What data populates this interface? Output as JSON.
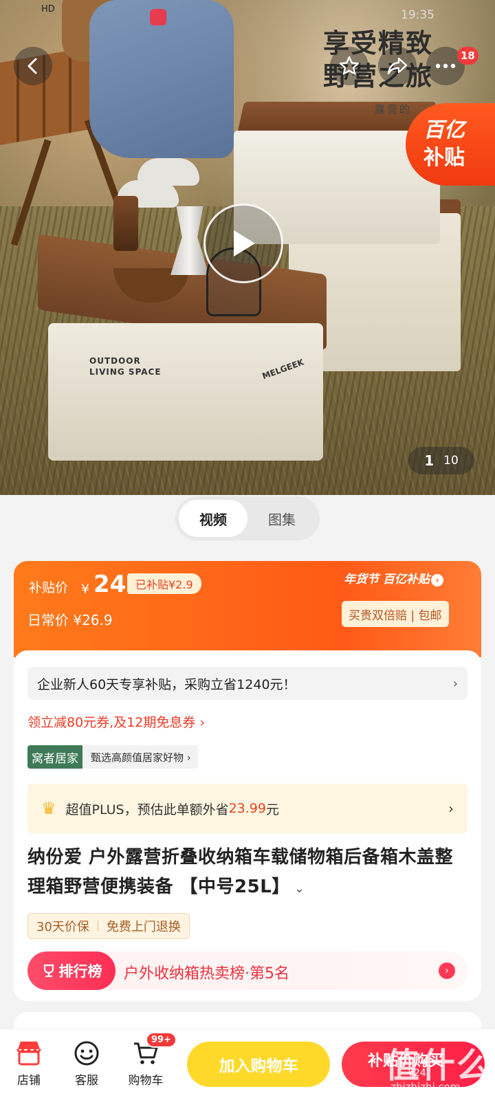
{
  "status_bar": {
    "left_text": "HD",
    "time": "19:35"
  },
  "hero": {
    "headline_line1": "享受精致",
    "headline_line2": "野营之旅",
    "subline": "露营的",
    "box_text": "OUTDOOR\nLIVING SPACE",
    "box_brand": "MELGEEK",
    "notification_count": "18",
    "subsidy_tag_line1": "百亿",
    "subsidy_tag_line2": "补贴",
    "pager_current": "1",
    "pager_total": "10"
  },
  "media_toggle": {
    "video": "视频",
    "gallery": "图集"
  },
  "price": {
    "label": "补贴价",
    "currency": "¥",
    "value": "24",
    "subsidy_badge": "已补贴¥2.9",
    "daily_label": "日常价 ¥26.9",
    "brand": "年货节 百亿补贴",
    "guarantee": "买贵双倍赔 | 包邮"
  },
  "info": {
    "promo": "企业新人60天专享补贴，采购立省1240元！",
    "coupon": "领立减80元券,及12期免息券 ›",
    "tag": "窝者居家",
    "tag_text": "甄选高颜值居家好物 ›",
    "plus_prefix": "超值PLUS，预估此单额外省",
    "plus_amount": "23.99",
    "plus_suffix": "元",
    "title": "纳份爱 户外露营折叠收纳箱车载储物箱后备箱木盖整理箱野营便携装备 【中号25L】",
    "assure_1": "30天价保",
    "assure_2": "免费上门退换",
    "rank_label": "排行榜",
    "rank_text": "户外收纳箱热卖榜·第5名"
  },
  "bottom_bar": {
    "shop": "店铺",
    "service": "客服",
    "cart": "购物车",
    "cart_badge": "99+",
    "add_to_cart": "加入购物车",
    "buy": "补贴价购买",
    "buy_price": "¥24"
  },
  "watermark": {
    "main": "值什么值",
    "url": "zhizhizhi.com"
  },
  "colors": {
    "accent": "#ff5a16",
    "cart_button": "#ffd92a",
    "buy_button": "#ff2e4c",
    "tag_green": "#3e7a57"
  }
}
